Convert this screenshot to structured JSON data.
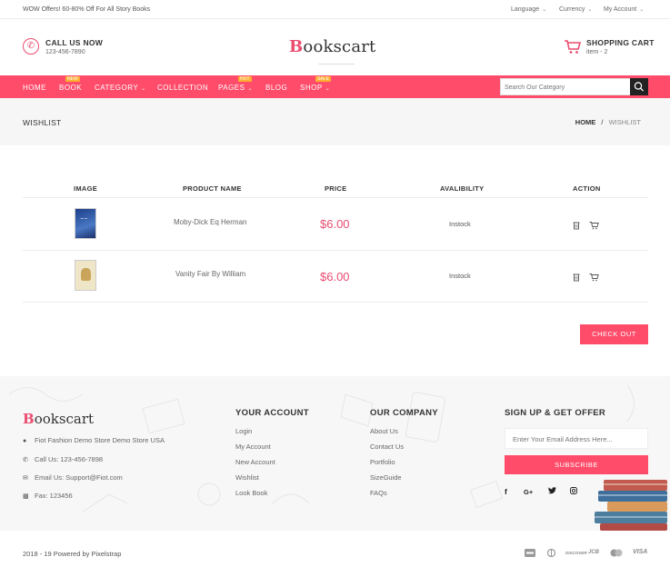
{
  "topbar": {
    "offer": "WOW Offers! 60-80% Off For All Story Books",
    "language": "Language",
    "currency": "Currency",
    "account": "My Account"
  },
  "header": {
    "call_title": "CALL US NOW",
    "call_number": "123-456-7890",
    "logo_b": "B",
    "logo_rest": "ookscart",
    "cart_title": "SHOPPING CART",
    "cart_items": "item - 2"
  },
  "nav": {
    "items": [
      {
        "label": "HOME"
      },
      {
        "label": "BOOK",
        "badge": "NEW"
      },
      {
        "label": "CATEGORY"
      },
      {
        "label": "COLLECTION"
      },
      {
        "label": "PAGES",
        "badge": "HOT"
      },
      {
        "label": "BLOG"
      },
      {
        "label": "SHOP",
        "badge": "SALE"
      }
    ],
    "search_placeholder": "Search Our Category"
  },
  "breadcrumb": {
    "title": "WISHLIST",
    "home": "HOME",
    "separator": "/",
    "current": "WISHLIST"
  },
  "table": {
    "headers": [
      "IMAGE",
      "PRODUCT NAME",
      "PRICE",
      "AVALIBILITY",
      "ACTION"
    ],
    "rows": [
      {
        "name": "Moby-Dick Eq Herman",
        "price": "$6.00",
        "availability": "Instock",
        "cover_color": "#2a4f9c"
      },
      {
        "name": "Vanity Fair By William",
        "price": "$6.00",
        "availability": "Instock",
        "cover_color": "#efe6c8"
      }
    ],
    "checkout_label": "CHECK OUT"
  },
  "footer": {
    "logo_b": "B",
    "logo_rest": "ookscart",
    "address": "Fiot Fashion Demo Store Demo Store USA",
    "phone": "Call Us: 123-456-7898",
    "email": "Email Us: Support@Fiot.com",
    "fax": "Fax: 123456",
    "your_account": {
      "heading": "YOUR ACCOUNT",
      "links": [
        "Login",
        "My Account",
        "New Account",
        "Wishlist",
        "Look Book"
      ]
    },
    "our_company": {
      "heading": "OUR COMPANY",
      "links": [
        "About Us",
        "Contact Us",
        "Portfolio",
        "SizeGuide",
        "FAQs"
      ]
    },
    "signup": {
      "heading": "SIGN UP & GET OFFER",
      "placeholder": "Enter Your Email Address Here...",
      "button": "SUBSCRIBE"
    },
    "social": [
      "f",
      "G+",
      "t",
      "ig"
    ],
    "copyright": "2018 - 19 Powered by Pixelstrap",
    "payments": [
      "AMEX",
      "Diners",
      "DISCOVER",
      "JCB",
      "MC",
      "VISA"
    ]
  },
  "colors": {
    "accent": "#ff4c6a",
    "price": "#ea4c6f",
    "badge": "#ffae33"
  }
}
